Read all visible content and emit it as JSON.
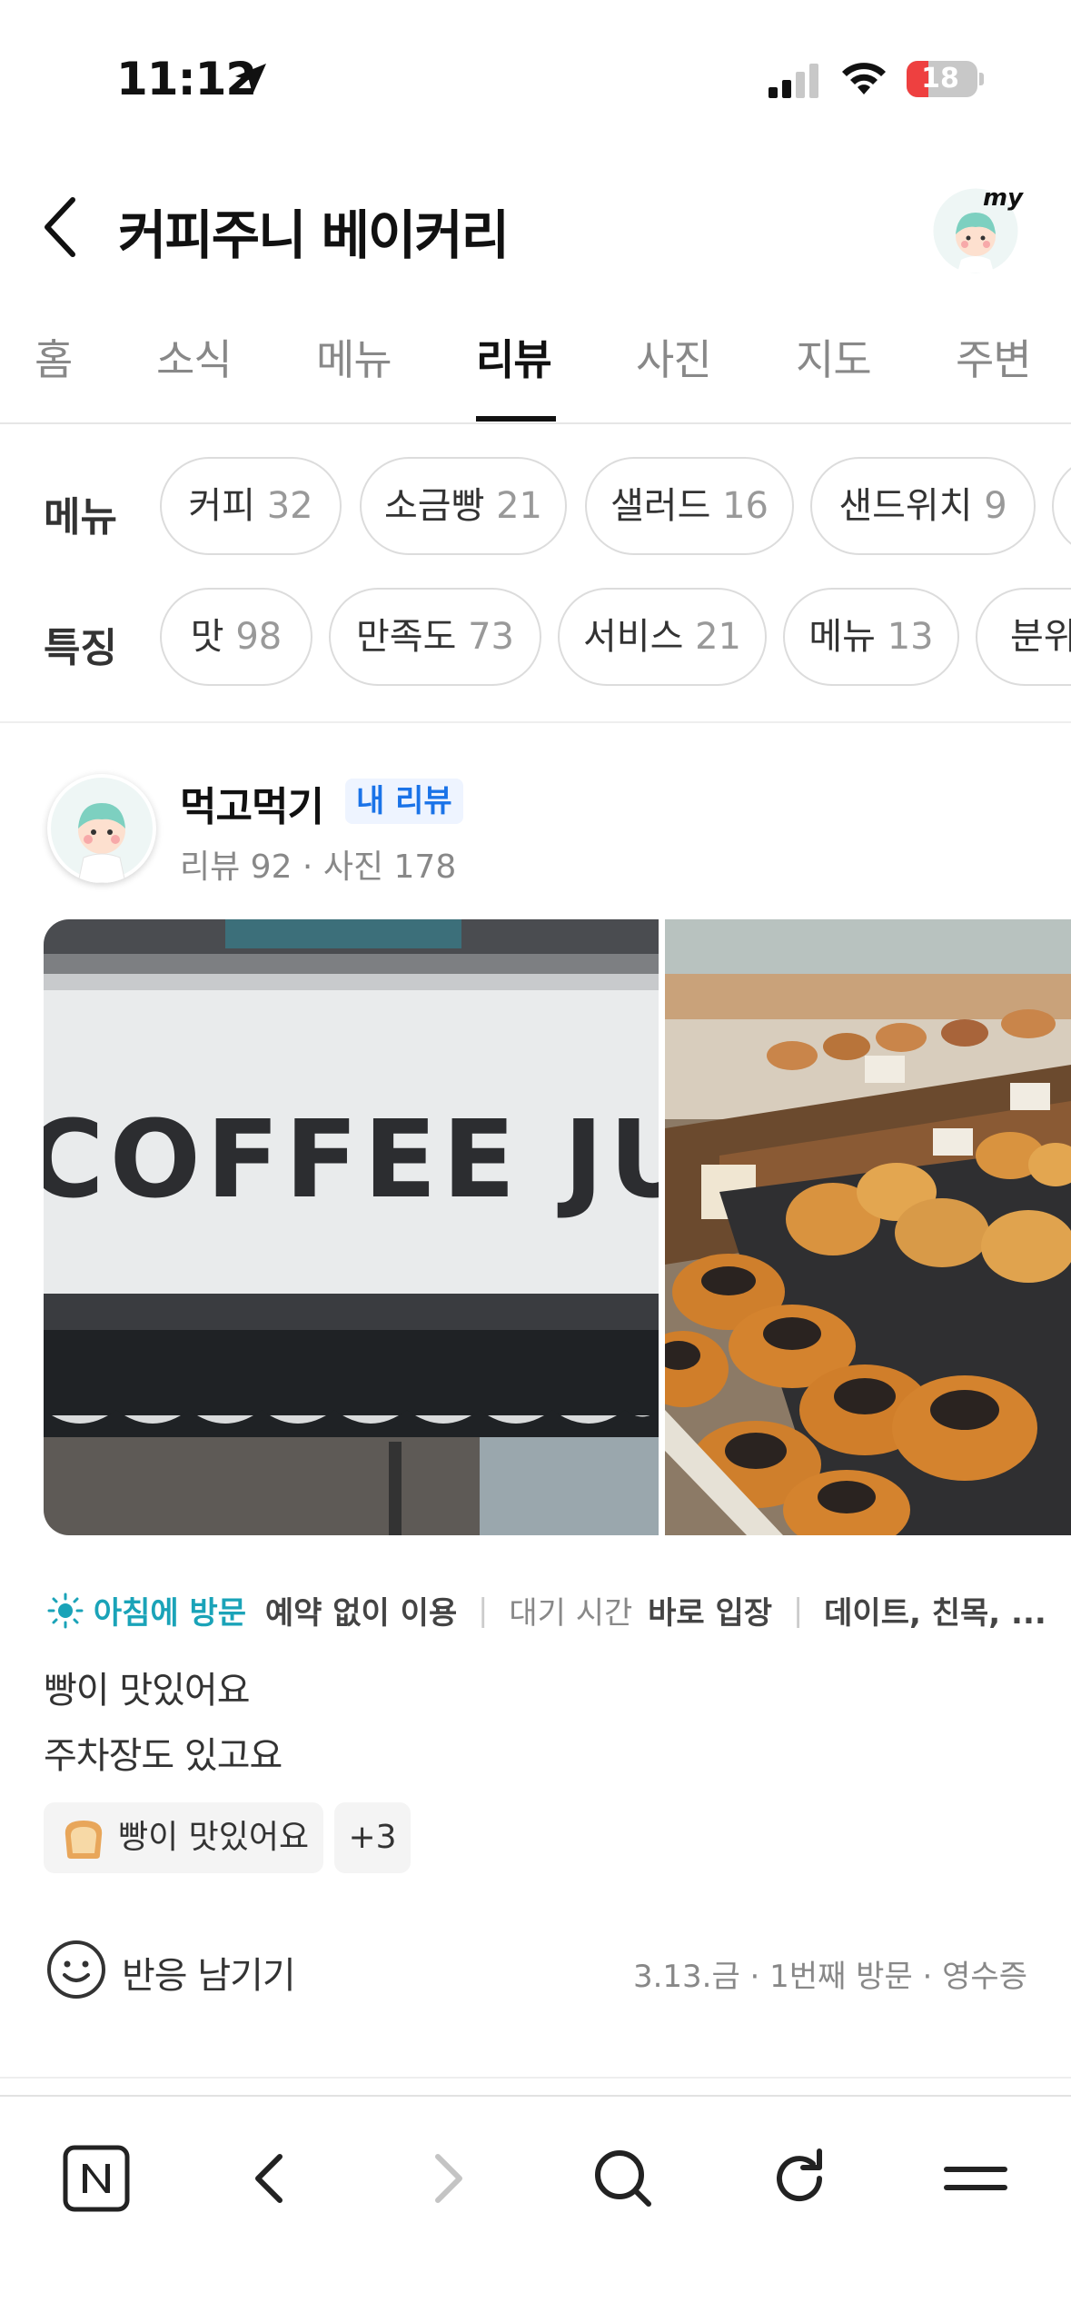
{
  "status_bar": {
    "time": "11:12",
    "battery_level": "18",
    "battery_percent": 18
  },
  "header": {
    "back_icon": "chevron-left-icon",
    "title": "커피주니 베이커리",
    "my_avatar_label": "my"
  },
  "tabs": [
    {
      "label": "홈"
    },
    {
      "label": "소식"
    },
    {
      "label": "메뉴"
    },
    {
      "label": "리뷰",
      "active": true
    },
    {
      "label": "사진"
    },
    {
      "label": "지도"
    },
    {
      "label": "주변"
    }
  ],
  "filters": {
    "menu": {
      "label": "메뉴",
      "chips": [
        {
          "name": "커피",
          "count": "32"
        },
        {
          "name": "소금빵",
          "count": "21"
        },
        {
          "name": "샐러드",
          "count": "16"
        },
        {
          "name": "샌드위치",
          "count": "9"
        }
      ]
    },
    "features": {
      "label": "특징",
      "chips": [
        {
          "name": "맛",
          "count": "98"
        },
        {
          "name": "만족도",
          "count": "73"
        },
        {
          "name": "서비스",
          "count": "21"
        },
        {
          "name": "메뉴",
          "count": "13"
        },
        {
          "name": "분위",
          "count": ""
        }
      ]
    }
  },
  "review": {
    "reviewer_name": "먹고먹기",
    "my_review_badge": "내 리뷰",
    "stats": "리뷰 92 · 사진 178",
    "photos": [
      {
        "sign_text": "COFFEE JUN"
      }
    ],
    "visit_time": "아침에 방문",
    "reservation": "예약 없이 이용",
    "wait_label": "대기 시간",
    "wait_value": "바로 입장",
    "purpose": "데이트, 친목, ...",
    "text_lines": [
      "빵이 맛있어요",
      "주차장도 있고요"
    ],
    "keyword": "빵이 맛있어요",
    "more_keywords": "+3",
    "reaction_label": "반응 남기기",
    "visit_meta": "3.13.금 · 1번째 방문 · 영수증"
  },
  "toolbar": {
    "icons": [
      "naver-home-icon",
      "back-arrow-icon",
      "forward-arrow-icon",
      "search-icon",
      "refresh-icon",
      "menu-icon"
    ]
  },
  "colors": {
    "accent_teal": "#1aa3b8",
    "badge_blue": "#1a73e8",
    "battery_red": "#ee4040"
  }
}
